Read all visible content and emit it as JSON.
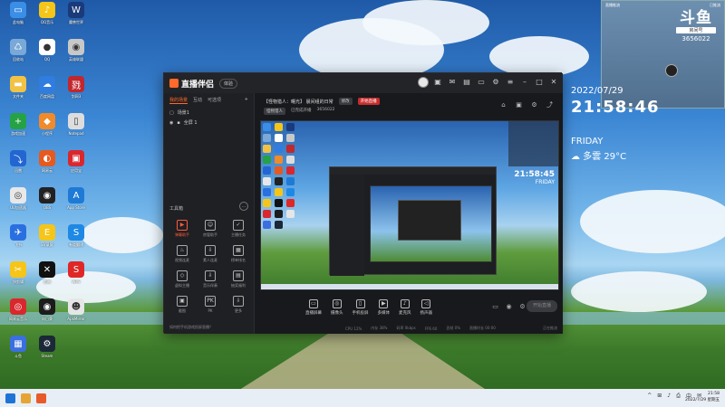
{
  "desktop": {
    "icons": [
      {
        "label": "此电脑",
        "color": "#3a8ee6",
        "glyph": "▭"
      },
      {
        "label": "QQ音乐",
        "color": "#f5c518",
        "glyph": "♪"
      },
      {
        "label": "魔兽世界",
        "color": "#1a3a7a",
        "glyph": "W"
      },
      {
        "label": "回收站",
        "color": "#7aa9d8",
        "glyph": "♺"
      },
      {
        "label": "QQ",
        "color": "#ffffff",
        "glyph": "●"
      },
      {
        "label": "英雄联盟",
        "color": "#c8c8c8",
        "glyph": "◉"
      },
      {
        "label": "文件夹",
        "color": "#f2c244",
        "glyph": "▬"
      },
      {
        "label": "百度网盘",
        "color": "#2f7de1",
        "glyph": "☁"
      },
      {
        "label": "剑网3",
        "color": "#c1272d",
        "glyph": "戮"
      },
      {
        "label": "游戏加速",
        "color": "#25a244",
        "glyph": "+"
      },
      {
        "label": "小程序",
        "color": "#f08a2a",
        "glyph": "◆"
      },
      {
        "label": "Notepad",
        "color": "#dddddd",
        "glyph": "▯"
      },
      {
        "label": "迅雷",
        "color": "#2366d1",
        "glyph": "⤵"
      },
      {
        "label": "网易云",
        "color": "#e55a1f",
        "glyph": "◐"
      },
      {
        "label": "应用宝",
        "color": "#d9272e",
        "glyph": "▣"
      },
      {
        "label": "UU加速器",
        "color": "#e8e8e8",
        "glyph": "◎"
      },
      {
        "label": "OBS",
        "color": "#222222",
        "glyph": "◉"
      },
      {
        "label": "App Store",
        "color": "#1f7ad6",
        "glyph": "A"
      },
      {
        "label": "飞书",
        "color": "#2a6fe0",
        "glyph": "✈"
      },
      {
        "label": "EV录屏",
        "color": "#f5c518",
        "glyph": "E"
      },
      {
        "label": "有道翻译",
        "color": "#1e88e5",
        "glyph": "S"
      },
      {
        "label": "快剪辑",
        "color": "#f5c518",
        "glyph": "✂"
      },
      {
        "label": "剪映",
        "color": "#111111",
        "glyph": "✕"
      },
      {
        "label": "WPS",
        "color": "#e02727",
        "glyph": "S"
      },
      {
        "label": "网易云音乐",
        "color": "#d9272e",
        "glyph": "◎"
      },
      {
        "label": "向日葵",
        "color": "#1c1c1c",
        "glyph": "◉"
      },
      {
        "label": "ApkMirror",
        "color": "#e6e6e6",
        "glyph": "☻"
      },
      {
        "label": "斗鱼",
        "color": "#3b6fe0",
        "glyph": "▦"
      },
      {
        "label": "Steam",
        "color": "#1b2838",
        "glyph": "⚙"
      }
    ]
  },
  "app": {
    "name": "直播伴侣",
    "version_pill": "体验",
    "left_tabs": [
      "我的场景",
      "互动",
      "可选项"
    ],
    "scene_header": "场景1",
    "scene_item": "全屏 1",
    "toolbox_title": "工具箱",
    "tools": [
      {
        "label": "弹幕助手",
        "glyph": "▶",
        "accent": true
      },
      {
        "label": "房管助手",
        "glyph": "☺",
        "accent": false
      },
      {
        "label": "主播任务",
        "glyph": "✓",
        "accent": false
      },
      {
        "label": "视频连麦",
        "glyph": "♨",
        "accent": false
      },
      {
        "label": "素人连麦",
        "glyph": "⇩",
        "accent": false
      },
      {
        "label": "榜单排名",
        "glyph": "▦",
        "accent": false
      },
      {
        "label": "虚拟主播",
        "glyph": "◇",
        "accent": false
      },
      {
        "label": "音乐伴奏",
        "glyph": "⇩",
        "accent": false
      },
      {
        "label": "抽奖福利",
        "glyph": "▤",
        "accent": false
      },
      {
        "label": "截图",
        "glyph": "▣",
        "accent": false
      },
      {
        "label": "PK",
        "glyph": "PK",
        "accent": false
      },
      {
        "label": "更多",
        "glyph": "⇩",
        "accent": false
      }
    ],
    "bottom_hint": "如何把手机游戏投屏直播？",
    "room": {
      "title": "【怪物猎人：曙光】 晨间组的日常",
      "tag1": "修改",
      "tag2": "开始直播",
      "category": "怪物猎人",
      "sub": "已完成开播",
      "room_id": "3656022"
    },
    "controls": [
      {
        "label": "直播屏幕",
        "glyph": "▭"
      },
      {
        "label": "摄像头",
        "glyph": "◎"
      },
      {
        "label": "手机投屏",
        "glyph": "▯"
      },
      {
        "label": "多媒体",
        "glyph": "▶"
      },
      {
        "label": "麦克风",
        "glyph": "♪"
      },
      {
        "label": "扬声器",
        "glyph": "◁"
      }
    ],
    "start_button": "开始直播",
    "status": [
      "CPU 12%",
      "内存 38%",
      "码率 0kbps",
      "FPS 60",
      "丢帧 0%",
      "直播时长 00:00"
    ],
    "status_right": "正在推流"
  },
  "preview": {
    "clock_date": "FRIDAY",
    "clock_time": "21:58:45"
  },
  "widget_topright": {
    "left_label": "直播推流",
    "right_label": "已推流",
    "brand": "斗鱼",
    "room_label": "房间号",
    "room_number": "3656022"
  },
  "clock": {
    "date": "2022/07/29",
    "time": "21:58:46",
    "day": "FRIDAY",
    "weather": "☁ 多雲 29°C"
  },
  "taskbar": {
    "apps": [
      "#1e74d6",
      "#e6a533",
      "#e75b2a"
    ],
    "tray": [
      "^",
      "⊞",
      "♪",
      "⎙",
      "中",
      "✉"
    ],
    "time": "21:58",
    "date": "2022/7/29 星期五"
  },
  "colors": {
    "accent": "#ff6a2a",
    "live_red": "#c82c2c"
  }
}
